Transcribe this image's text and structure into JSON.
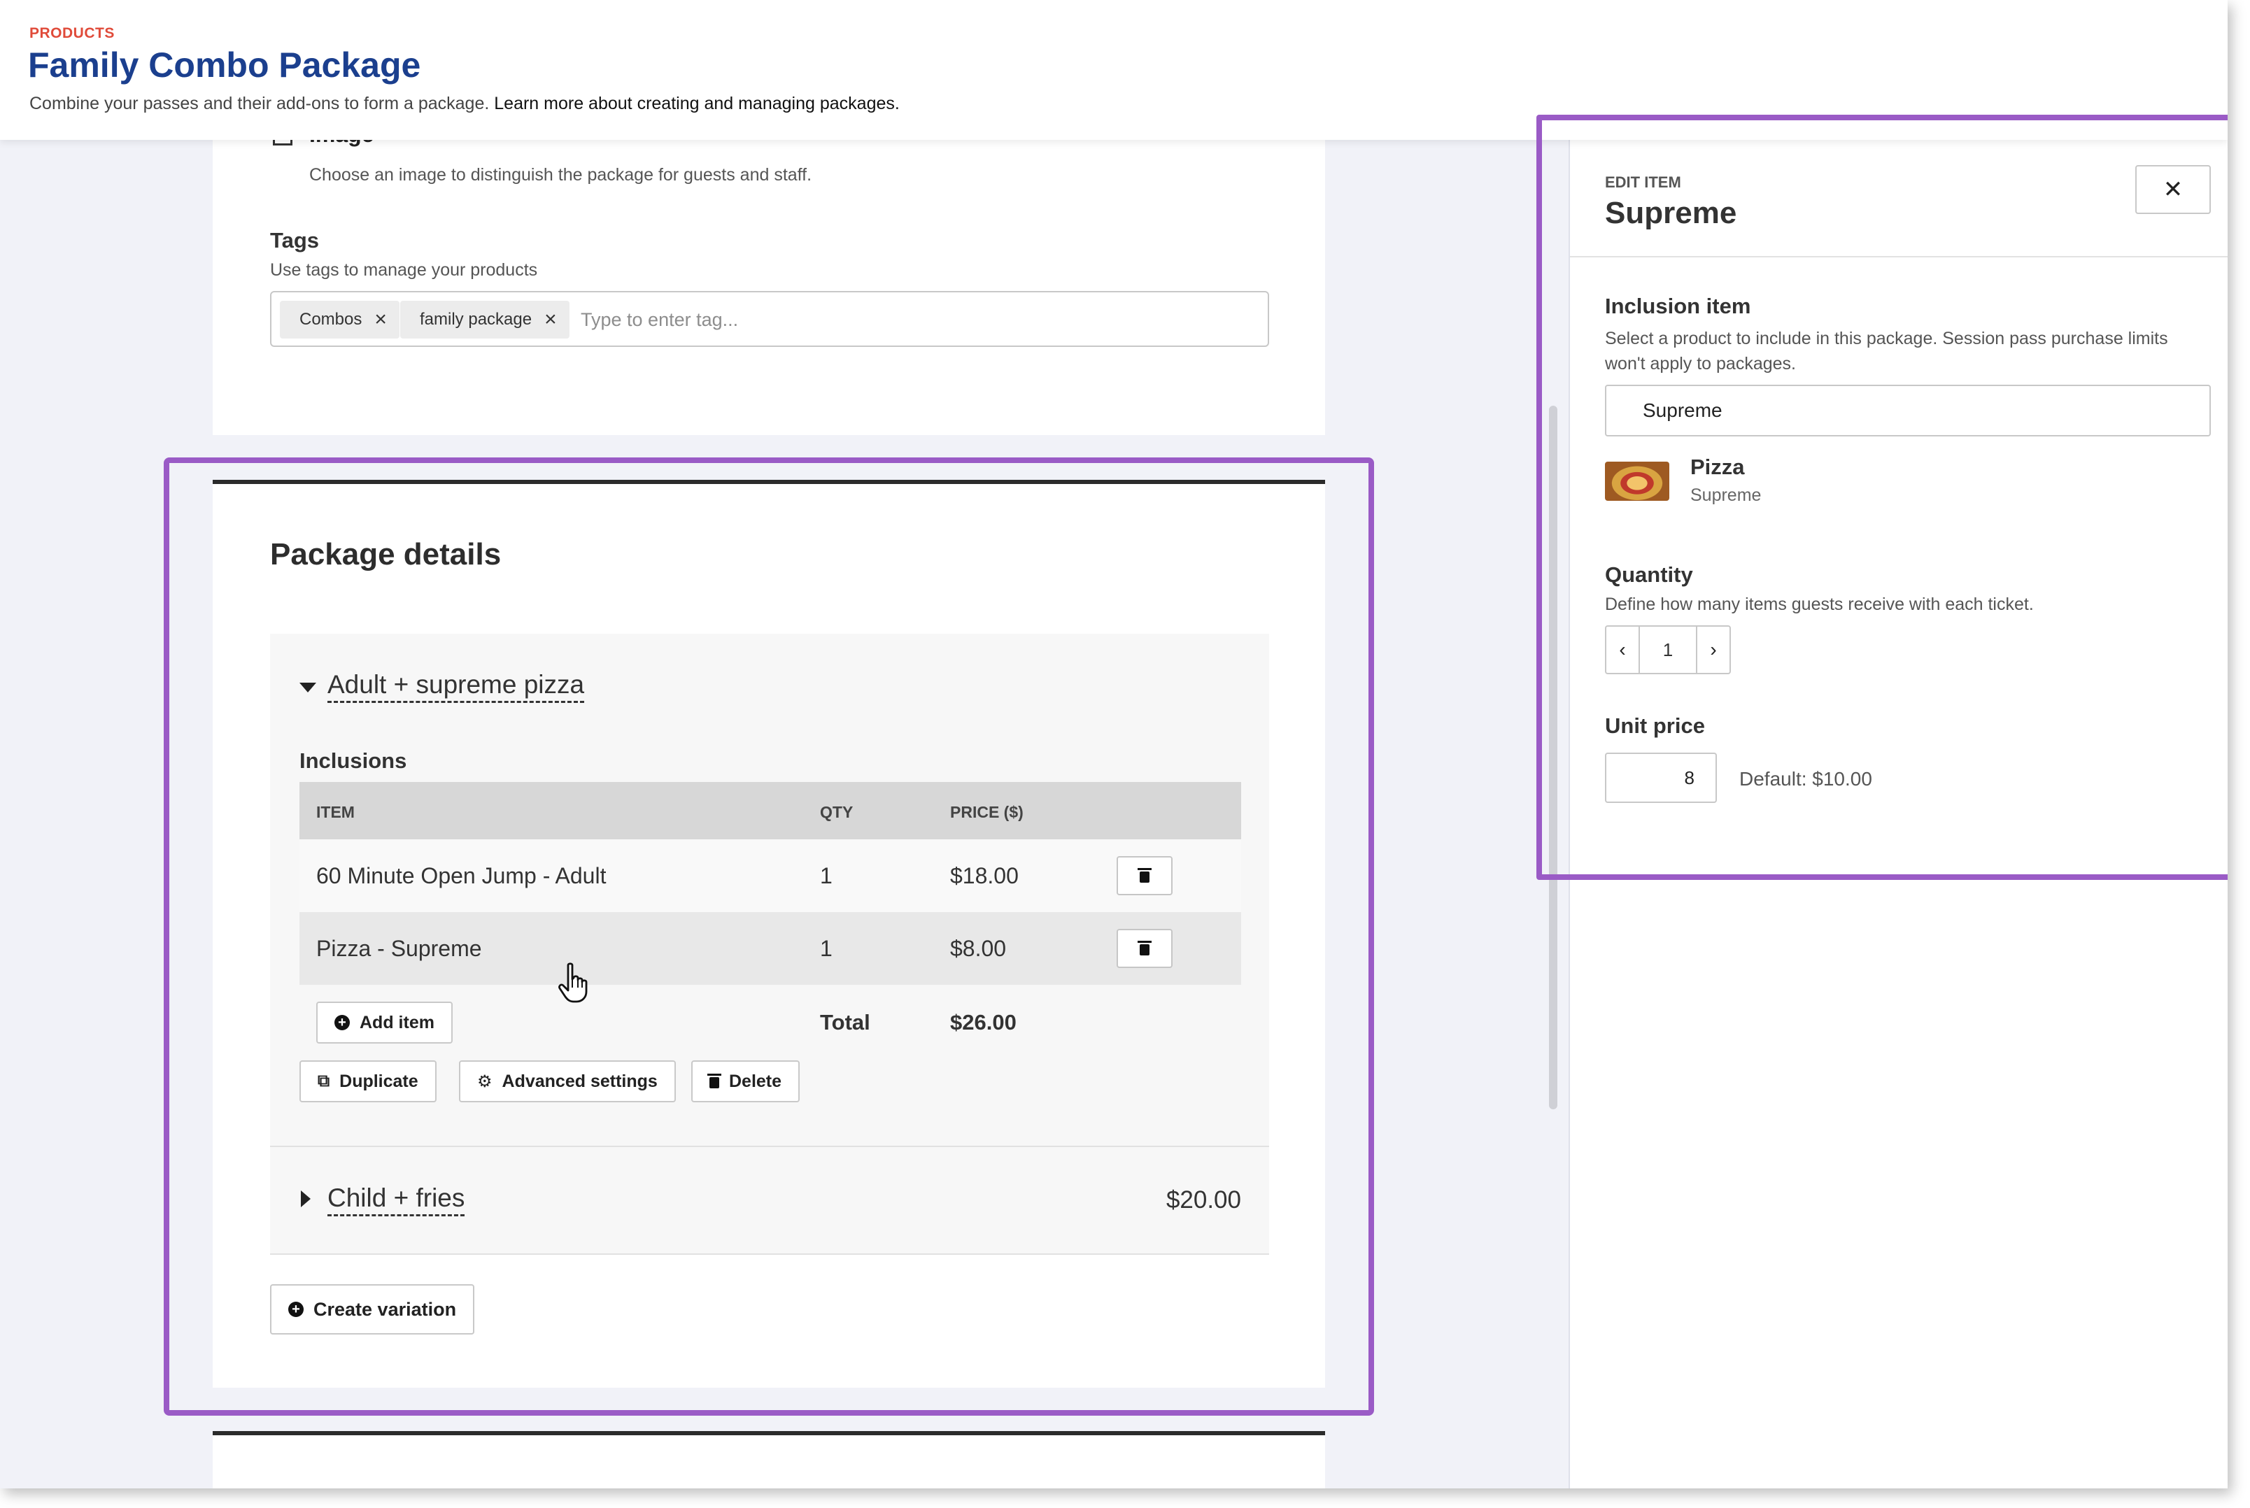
{
  "header": {
    "eyebrow": "PRODUCTS",
    "title": "Family Combo Package",
    "description": "Combine your passes and their add-ons to form a package.",
    "description_link": "Learn more about creating and managing packages."
  },
  "image_section": {
    "label": "Image",
    "help": "Choose an image to distinguish the package for guests and staff."
  },
  "tags": {
    "label": "Tags",
    "help": "Use tags to manage your products",
    "items": [
      "Combos",
      "family package"
    ],
    "remove_glyph": "×",
    "placeholder": "Type to enter tag..."
  },
  "package_details": {
    "title": "Package details",
    "variations": [
      {
        "name": "Adult + supreme pizza",
        "expanded": true,
        "inclusions_label": "Inclusions",
        "table": {
          "headers": {
            "item": "ITEM",
            "qty": "QTY",
            "price": "PRICE ($)"
          },
          "rows": [
            {
              "item": "60 Minute Open Jump - Adult",
              "qty": "1",
              "price": "$18.00"
            },
            {
              "item": "Pizza - Supreme",
              "qty": "1",
              "price": "$8.00"
            }
          ],
          "add_item_label": "Add item",
          "total_label": "Total",
          "total_value": "$26.00"
        },
        "actions": {
          "duplicate": "Duplicate",
          "advanced_settings": "Advanced settings",
          "delete": "Delete"
        }
      },
      {
        "name": "Child + fries",
        "expanded": false,
        "price": "$20.00"
      }
    ],
    "create_variation_label": "Create variation"
  },
  "side_panel": {
    "eyebrow": "EDIT ITEM",
    "title": "Supreme",
    "close_glyph": "✕",
    "inclusion_item": {
      "label": "Inclusion item",
      "help": "Select a product to include in this package. Session pass purchase limits won't apply to packages.",
      "value": "Supreme",
      "product_name": "Pizza",
      "product_variant": "Supreme"
    },
    "quantity": {
      "label": "Quantity",
      "help": "Define how many items guests receive with each ticket.",
      "value": "1",
      "dec_glyph": "‹",
      "inc_glyph": "›"
    },
    "unit_price": {
      "label": "Unit price",
      "value": "8",
      "default_text": "Default: $10.00"
    }
  },
  "colors": {
    "title_blue": "#1b3f8e",
    "eyebrow_red": "#e04b3a",
    "highlight_purple": "#9a5bc6",
    "page_bg": "#f1f2f8"
  },
  "icons": {
    "close": "close-icon",
    "trash": "trash-icon",
    "add": "plus-circle-icon",
    "duplicate": "duplicate-icon",
    "settings": "gear-icon",
    "expand": "caret-down-icon",
    "collapse": "caret-right-icon",
    "cursor": "hand-pointer-icon"
  }
}
